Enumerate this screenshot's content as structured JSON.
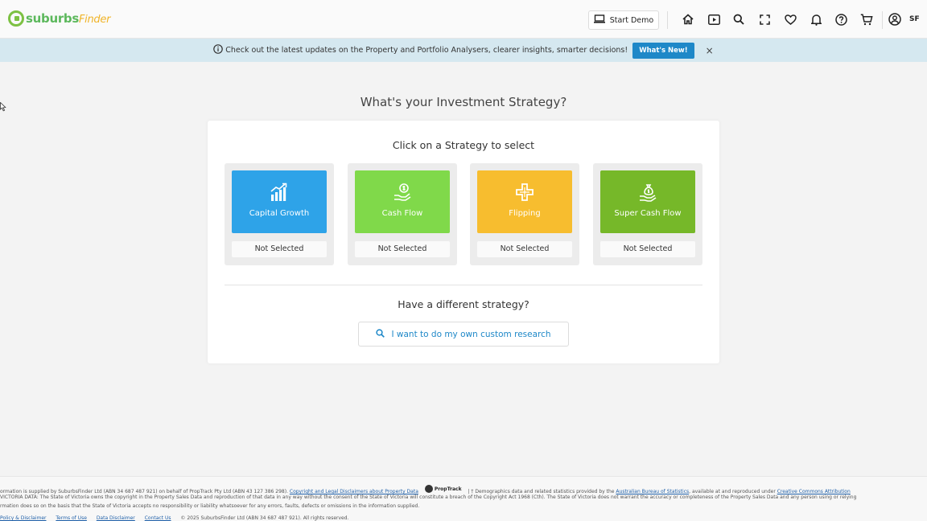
{
  "header": {
    "logo_text_1": "suburbs",
    "logo_text_2": "Finder",
    "start_demo": "Start Demo",
    "user_initials": "SF",
    "nav_icons": [
      "home-icon",
      "play-icon",
      "search-icon",
      "fullscreen-icon",
      "heart-icon",
      "bell-icon",
      "help-icon",
      "cart-icon",
      "user-icon"
    ]
  },
  "banner": {
    "message": "Check out the latest updates on the Property and Portfolio Analysers, clearer insights, smarter decisions!",
    "button": "What's New!",
    "close": "×"
  },
  "main": {
    "title": "What's your Investment Strategy?",
    "subtitle": "Click on a Strategy to select",
    "strategies": [
      {
        "label": "Capital Growth",
        "status": "Not Selected",
        "color": "#2ea3e8",
        "icon": "chart-growth-icon"
      },
      {
        "label": "Cash Flow",
        "status": "Not Selected",
        "color": "#80d94a",
        "icon": "cash-hand-icon"
      },
      {
        "label": "Flipping",
        "status": "Not Selected",
        "color": "#f7bd2f",
        "icon": "flip-arrows-icon"
      },
      {
        "label": "Super Cash Flow",
        "status": "Not Selected",
        "color": "#76b829",
        "icon": "money-bag-hand-icon"
      }
    ],
    "different_title": "Have a different strategy?",
    "custom_button": "I want to do my own custom research"
  },
  "footer": {
    "line1_a": "ormation is supplied by SuburbsFinder Ltd (ABN 34 687 487 921) on behalf of PropTrack Pty Ltd (ABN 43 127 386 298).",
    "line1_link1": "Copyright and Legal Disclaimers about Property Data",
    "proptrack": "PropTrack",
    "line1_b": "| † Demographics data and related statistics provided by the",
    "line1_link2": "Australian Bureau of Statistics",
    "line1_c": ", available at and reproduced under",
    "line1_link3": "Creative Commons Attribution",
    "line2": "VICTORIA DATA: The State of Victoria owns the copyright in the Property Sales Data and reproduction of that data in any way without the consent of the State of Victoria will constitute a breach of the Copyright Act 1968 (Cth). The State of Victoria does not warrant the accuracy or completeness of the Property Sales Data and any person using or relying",
    "line3": "rmation does so on the basis that the State of Victoria accepts no responsibility or liability whatsoever for any errors, faults, defects or omissions in the information supplied.",
    "links": [
      "Policy & Disclaimer",
      "Terms of Use",
      "Data Disclaimer",
      "Contact Us"
    ],
    "copyright": "© 2025 SuburbsFinder Ltd (ABN 34 687 487 921). All rights reserved."
  }
}
